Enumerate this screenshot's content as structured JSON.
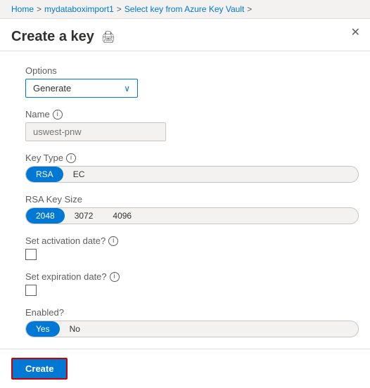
{
  "breadcrumb": {
    "items": [
      {
        "label": "Home"
      },
      {
        "label": "mydataboximport1"
      },
      {
        "label": "Select key from Azure Key Vault"
      }
    ],
    "separator": ">"
  },
  "header": {
    "title": "Create a key",
    "print_icon": "🖨",
    "close_icon": "✕"
  },
  "form": {
    "options_label": "Options",
    "options_value": "Generate",
    "name_label": "Name",
    "name_placeholder": "uswest-pnw",
    "key_type_label": "Key Type",
    "key_type_options": [
      {
        "label": "RSA",
        "active": true
      },
      {
        "label": "EC",
        "active": false
      }
    ],
    "rsa_key_size_label": "RSA Key Size",
    "rsa_key_size_options": [
      {
        "label": "2048",
        "active": true
      },
      {
        "label": "3072",
        "active": false
      },
      {
        "label": "4096",
        "active": false
      }
    ],
    "activation_date_label": "Set activation date?",
    "expiration_date_label": "Set expiration date?",
    "enabled_label": "Enabled?",
    "enabled_options": [
      {
        "label": "Yes",
        "active": true
      },
      {
        "label": "No",
        "active": false
      }
    ]
  },
  "footer": {
    "create_button_label": "Create"
  },
  "icons": {
    "info": "i",
    "chevron_down": "∨",
    "print": "🖨",
    "close": "×"
  }
}
